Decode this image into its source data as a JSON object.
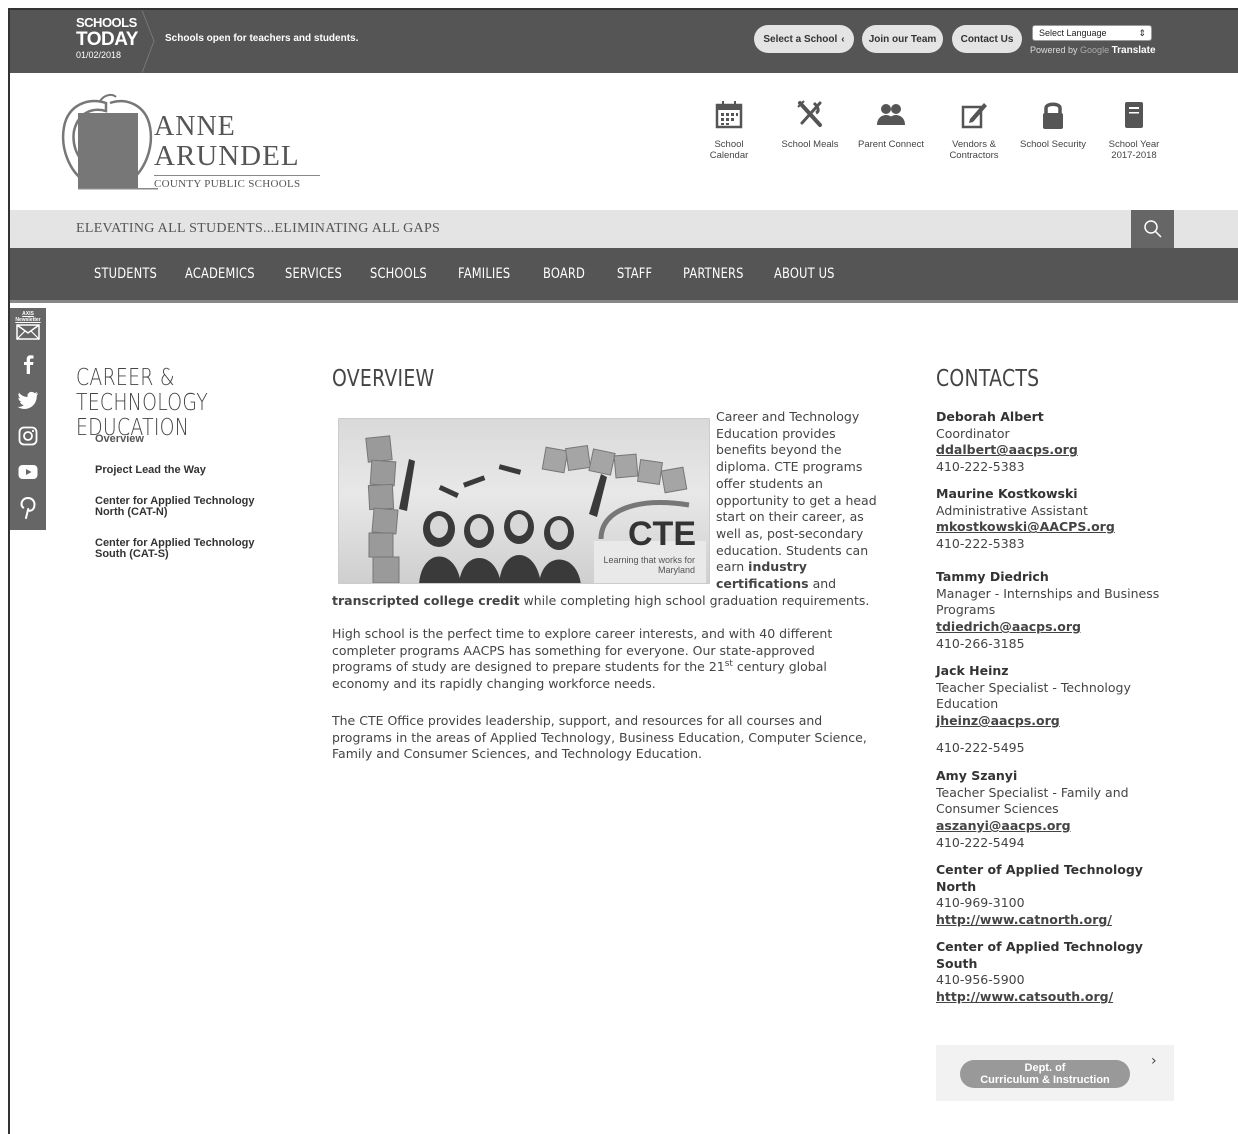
{
  "topbar": {
    "schools_today_l1": "SCHOOLS",
    "schools_today_l2": "TODAY",
    "date": "01/02/2018",
    "message": "Schools open for teachers and students.",
    "select_school": "Select a School",
    "join_team": "Join our Team",
    "contact_us": "Contact Us",
    "language_select": "Select Language",
    "powered_by": "Powered by",
    "google": "Google",
    "translate": "Translate"
  },
  "logo": {
    "line1": "ANNE",
    "line2": "ARUNDEL",
    "line3": "COUNTY PUBLIC SCHOOLS"
  },
  "quick_links": [
    {
      "label": "School Calendar",
      "icon": "calendar-icon"
    },
    {
      "label": "School Meals",
      "icon": "utensils-icon"
    },
    {
      "label": "Parent Connect",
      "icon": "people-icon"
    },
    {
      "label": "Vendors & Contractors",
      "icon": "pencil-note-icon"
    },
    {
      "label": "School Security",
      "icon": "lock-icon"
    },
    {
      "label": "School Year 2017-2018",
      "icon": "document-icon"
    }
  ],
  "tagline": "ELEVATING ALL STUDENTS...ELIMINATING ALL GAPS",
  "nav": [
    "STUDENTS",
    "ACADEMICS",
    "SERVICES",
    "SCHOOLS",
    "FAMILIES",
    "BOARD",
    "STAFF",
    "PARTNERS",
    "ABOUT US"
  ],
  "social": {
    "axis_label": "AXIS Newsletter",
    "items": [
      "mail-icon",
      "facebook-icon",
      "twitter-icon",
      "instagram-icon",
      "youtube-icon",
      "pinterest-icon"
    ]
  },
  "sidebar": {
    "title": "CAREER & TECHNOLOGY EDUCATION",
    "links": [
      {
        "label": "Overview"
      },
      {
        "label": "Project Lead the Way"
      },
      {
        "label": "Center for Applied Technology North (CAT-N)"
      },
      {
        "label": "Center for Applied Technology South (CAT-S)"
      }
    ]
  },
  "overview": {
    "title": "OVERVIEW",
    "image": {
      "logo_text": "CTE",
      "tagline": "Learning that works for Maryland"
    },
    "p1_a": "Career and Technology Education provides benefits beyond the diploma.  CTE programs offer students an opportunity to get a head start on their career, as well as, post-secondary education.  Students can earn ",
    "p1_b": "industry certifications",
    "p1_c": " and ",
    "p1_d": "transcripted college credit",
    "p1_e": " while completing high school graduation requirements.",
    "p2_a": "High school is the perfect time to explore career interests, and with 40 different completer programs AACPS has something for everyone. Our state-approved programs of study are designed to prepare students for the 21",
    "p2_sup": "st",
    "p2_b": " century global economy and its rapidly changing workforce needs.",
    "p3": "The CTE Office provides leadership, support, and resources for all courses and programs in the areas of Applied Technology, Business Education, Computer Science, Family and Consumer Sciences, and Technology Education."
  },
  "contacts": {
    "title": "CONTACTS",
    "people": [
      {
        "name": "Deborah Albert",
        "role": "Coordinator",
        "email": "ddalbert@aacps.org",
        "phone": "410-222-5383"
      },
      {
        "name": "Maurine Kostkowski",
        "role": "Administrative Assistant",
        "email": "mkostkowski@AACPS.org",
        "phone": "410-222-5383"
      },
      {
        "name": "Tammy Diedrich",
        "role": "Manager - Internships and Business Programs",
        "email": "tdiedrich@aacps.org",
        "phone": "410-266-3185"
      },
      {
        "name": "Jack Heinz",
        "role": "Teacher Specialist - Technology Education",
        "email": "jheinz@aacps.org",
        "phone": "410-222-5495"
      },
      {
        "name": "Amy Szanyi",
        "role": "Teacher Specialist - Family and Consumer Sciences",
        "email": "aszanyi@aacps.org",
        "phone": "410-222-5494"
      },
      {
        "name": "Center of Applied Technology North",
        "phone": "410-969-3100",
        "url": "http://www.catnorth.org/"
      },
      {
        "name": "Center of Applied Technology South",
        "phone": "410-956-5900",
        "url": "http://www.catsouth.org/"
      }
    ]
  },
  "curriculum_button": {
    "line1": "Dept. of",
    "line2": "Curriculum & Instruction"
  }
}
